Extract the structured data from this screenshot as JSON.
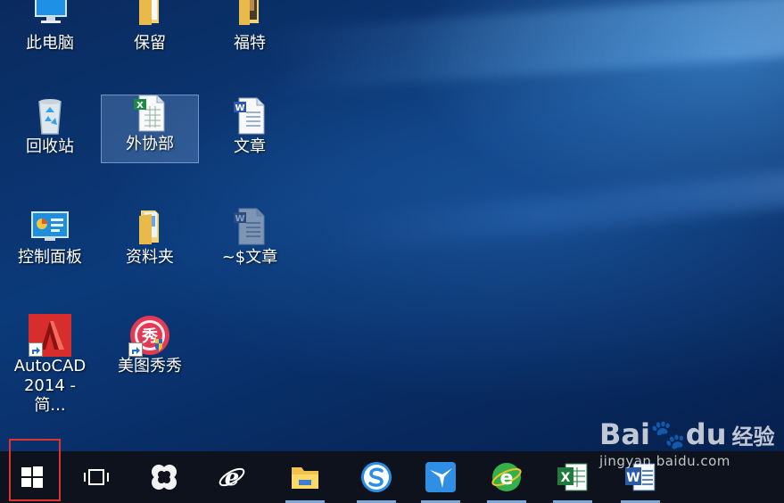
{
  "desktop": {
    "icons": [
      {
        "label": "此电脑"
      },
      {
        "label": "保留"
      },
      {
        "label": "福特"
      },
      {
        "label": "回收站"
      },
      {
        "label": "外协部"
      },
      {
        "label": "文章"
      },
      {
        "label": "控制面板"
      },
      {
        "label": "资料夹"
      },
      {
        "label": "~$文章"
      },
      {
        "label": "AutoCAD\n2014 - 简..."
      },
      {
        "label": "美图秀秀"
      }
    ]
  },
  "taskbar": {
    "items": [
      {
        "name": "start",
        "icon": "windows-logo-icon"
      },
      {
        "name": "task-view",
        "icon": "task-view-icon"
      },
      {
        "name": "pinwheel-app",
        "icon": "pinwheel-icon"
      },
      {
        "name": "internet-explorer",
        "icon": "ie-icon"
      },
      {
        "name": "file-explorer",
        "icon": "folder-icon"
      },
      {
        "name": "sogou",
        "icon": "sogou-s-icon"
      },
      {
        "name": "xunlei",
        "icon": "bird-icon"
      },
      {
        "name": "360-browser",
        "icon": "green-e-icon"
      },
      {
        "name": "excel",
        "icon": "excel-icon"
      },
      {
        "name": "word",
        "icon": "word-icon"
      }
    ]
  },
  "watermark": {
    "logo_text": "Bai",
    "logo_suffix": "du",
    "title": "经验",
    "url": "jingyan.baidu.com"
  }
}
